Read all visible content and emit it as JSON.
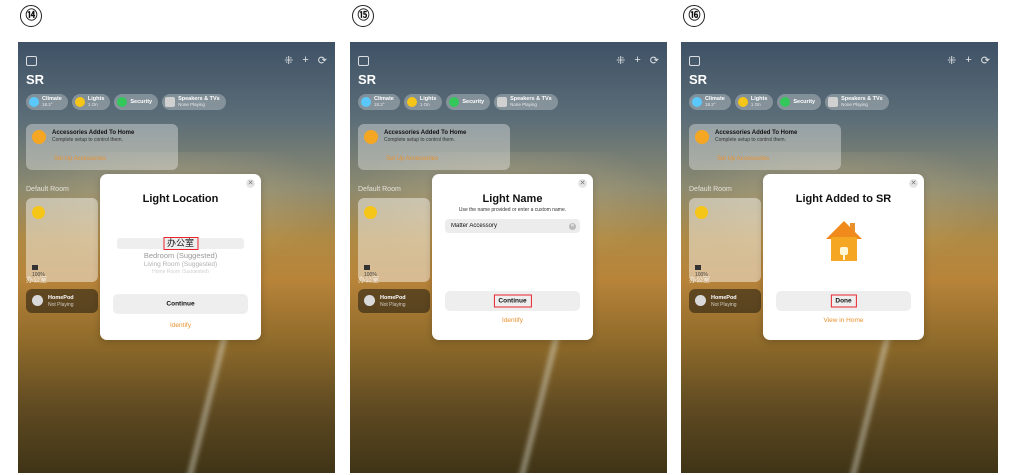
{
  "steps": [
    {
      "number": "⑭",
      "home": {
        "name": "SR",
        "chips": [
          {
            "title": "Climate",
            "sub": "18.2°",
            "icon": "fan-icon",
            "color": "#5ac8fa"
          },
          {
            "title": "Lights",
            "sub": "1 On",
            "icon": "lightbulb-icon",
            "color": "#f5c518"
          },
          {
            "title": "Security",
            "sub": "",
            "icon": "lock-icon",
            "color": "#34c759"
          },
          {
            "title": "Speakers & TVs",
            "sub": "None Playing",
            "icon": "tv-icon",
            "color": "#d0d0d0"
          }
        ],
        "notice": {
          "title": "Accessories Added To Home",
          "sub": "Complete setup to control them.",
          "link": "Set Up Accessories"
        },
        "section1": "Default Room",
        "tile_sub": "100%",
        "section2": "办公室",
        "homepod": {
          "title": "HomePod",
          "sub": "Not Playing"
        }
      },
      "modal": {
        "title": "Light Location",
        "wheel": {
          "selected": "办公室",
          "items": [
            "Bedroom (Suggested)",
            "Living Room (Suggested)",
            "Home Room (Suggested)"
          ]
        },
        "primary": "Continue",
        "link": "Identify"
      }
    },
    {
      "number": "⑮",
      "home": {
        "name": "SR",
        "chips": [
          {
            "title": "Climate",
            "sub": "18.2°",
            "icon": "fan-icon",
            "color": "#5ac8fa"
          },
          {
            "title": "Lights",
            "sub": "1 On",
            "icon": "lightbulb-icon",
            "color": "#f5c518"
          },
          {
            "title": "Security",
            "sub": "",
            "icon": "lock-icon",
            "color": "#34c759"
          },
          {
            "title": "Speakers & TVs",
            "sub": "None Playing",
            "icon": "tv-icon",
            "color": "#d0d0d0"
          }
        ],
        "notice": {
          "title": "Accessories Added To Home",
          "sub": "Complete setup to control them.",
          "link": "Set Up Accessories"
        },
        "section1": "Default Room",
        "tile_sub": "100%",
        "section2": "办公室",
        "homepod": {
          "title": "HomePod",
          "sub": "Not Playing"
        }
      },
      "modal": {
        "title": "Light Name",
        "subtitle": "Use the name provided or enter a custom name.",
        "field_value": "Matter Accessory",
        "primary": "Continue",
        "link": "Identify"
      }
    },
    {
      "number": "⑯",
      "home": {
        "name": "SR",
        "chips": [
          {
            "title": "Climate",
            "sub": "18.2°",
            "icon": "fan-icon",
            "color": "#5ac8fa"
          },
          {
            "title": "Lights",
            "sub": "1 On",
            "icon": "lightbulb-icon",
            "color": "#f5c518"
          },
          {
            "title": "Security",
            "sub": "",
            "icon": "lock-icon",
            "color": "#34c759"
          },
          {
            "title": "Speakers & TVs",
            "sub": "None Playing",
            "icon": "tv-icon",
            "color": "#d0d0d0"
          }
        ],
        "notice": {
          "title": "Accessories Added To Home",
          "sub": "Complete setup to control them.",
          "link": "Set Up Accessories"
        },
        "section1": "Default Room",
        "tile_sub": "100%",
        "section2": "办公室",
        "homepod": {
          "title": "HomePod",
          "sub": "Not Playing"
        }
      },
      "modal": {
        "title": "Light Added to SR",
        "icon": "home-icon",
        "primary": "Done",
        "link": "View in Home"
      }
    }
  ],
  "colors": {
    "accent": "#e8912f",
    "highlight": "#e8242e",
    "house_orange": "#f5a623"
  }
}
